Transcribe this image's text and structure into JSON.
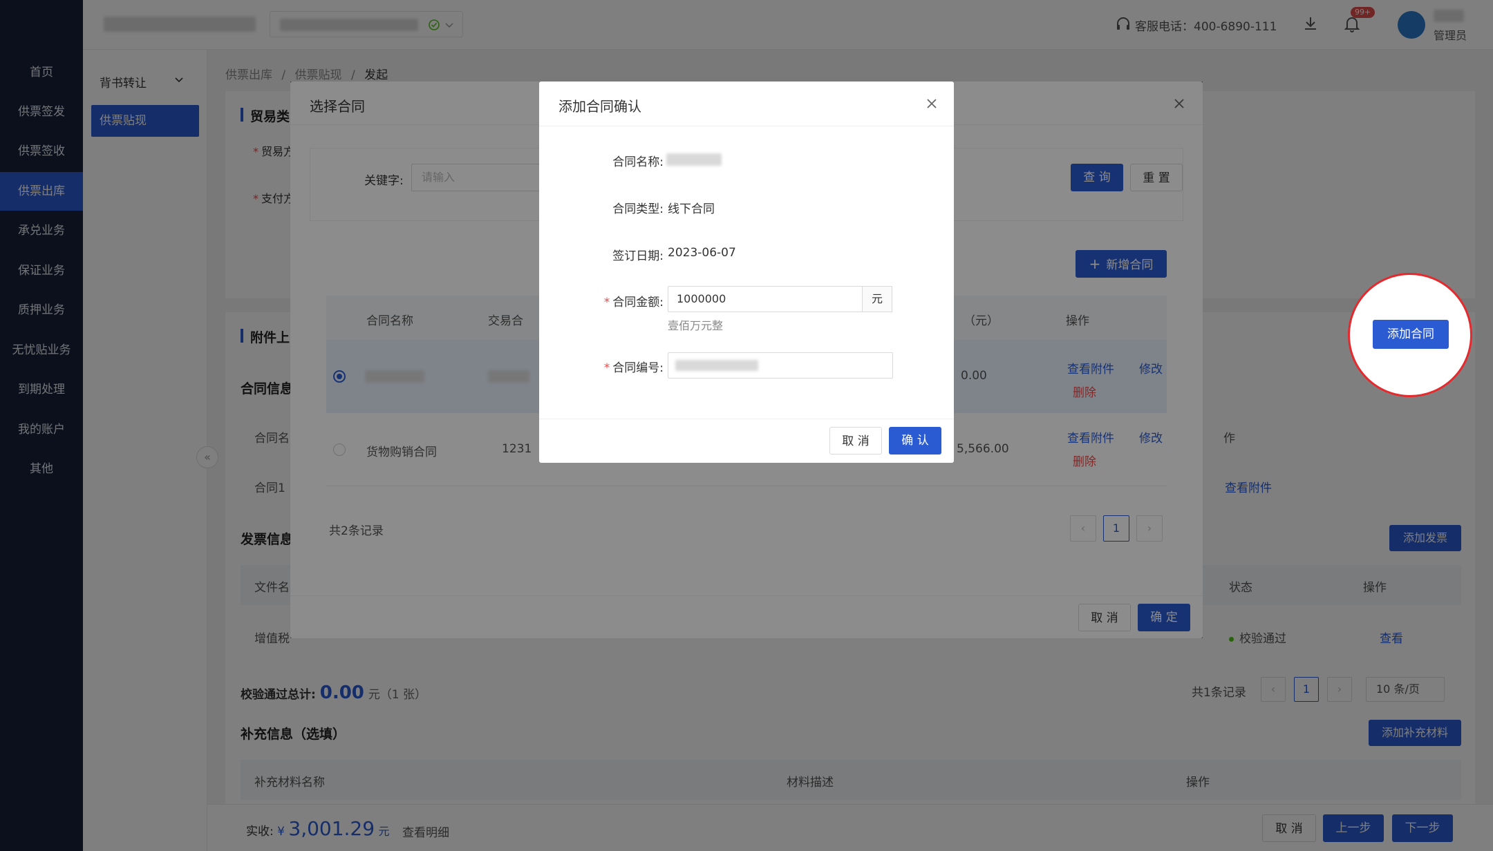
{
  "sidebar": {
    "items": [
      {
        "label": "首页"
      },
      {
        "label": "供票签发"
      },
      {
        "label": "供票签收"
      },
      {
        "label": "供票出库"
      },
      {
        "label": "承兑业务"
      },
      {
        "label": "保证业务"
      },
      {
        "label": "质押业务"
      },
      {
        "label": "无忧贴业务"
      },
      {
        "label": "到期处理"
      },
      {
        "label": "我的账户"
      },
      {
        "label": "其他"
      }
    ]
  },
  "topbar": {
    "hotline": "客服电话：400-6890-111",
    "badge": "99+",
    "role": "管理员"
  },
  "subnav": {
    "group": "背书转让",
    "active": "供票贴现"
  },
  "breadcrumb": {
    "items": [
      "供票出库",
      "供票贴现",
      "发起"
    ]
  },
  "page": {
    "trade_section": "贸易类",
    "trade_field1": "贸易方",
    "trade_field2": "支付方",
    "attach_section": "附件上",
    "contract_info": "合同信息",
    "contract_rows": [
      {
        "name": "合同名"
      },
      {
        "name": "合同1",
        "action": "查看附件"
      }
    ],
    "status_col": "作",
    "invoice_info": "发票信息",
    "add_invoice": "添加发票",
    "invoice_head": {
      "file": "文件名",
      "status": "状态",
      "op": "操作"
    },
    "invoice_row": {
      "file": "增值税",
      "status": "校验通过",
      "op": "查看"
    },
    "verify_total_label": "校验通过总计:",
    "verify_total_value": "0.00",
    "verify_total_unit": "元（1 张）",
    "records": "共1条记录",
    "page_no": "1",
    "page_size": "10 条/页",
    "supplement_title": "补充信息（选填）",
    "add_supplement": "添加补充材料",
    "supplement_head": {
      "name": "补充材料名称",
      "desc": "材料描述",
      "op": "操作"
    },
    "received_label": "实收:",
    "received_currency": "¥",
    "received_value": "3,001.29",
    "received_unit": "元",
    "view_detail": "查看明细",
    "footer_cancel": "取 消",
    "footer_prev": "上一步",
    "footer_next": "下一步"
  },
  "highlight": {
    "label": "添加合同"
  },
  "select_modal": {
    "title": "选择合同",
    "keyword_label": "关键字:",
    "keyword_placeholder": "请输入",
    "query": "查 询",
    "reset": "重 置",
    "new_contract": "新增合同",
    "columns": {
      "name": "合同名称",
      "trade": "交易合",
      "amount": "（元）",
      "op": "操作"
    },
    "rows": [
      {
        "number": "",
        "amount": "0.00",
        "view": "查看附件",
        "edit": "修改",
        "del": "删除"
      },
      {
        "name": "货物购销合同",
        "number": "1231",
        "amount": "5,566.00",
        "view": "查看附件",
        "edit": "修改",
        "del": "删除"
      }
    ],
    "total": "共2条记录",
    "page_no": "1",
    "cancel": "取 消",
    "ok": "确 定"
  },
  "confirm_modal": {
    "title": "添加合同确认",
    "name_label": "合同名称:",
    "type_label": "合同类型:",
    "type_value": "线下合同",
    "date_label": "签订日期:",
    "date_value": "2023-06-07",
    "amount_label": "合同金额:",
    "amount_value": "1000000",
    "amount_unit": "元",
    "amount_words": "壹佰万元整",
    "number_label": "合同编号:",
    "cancel": "取 消",
    "ok": "确 认"
  },
  "colors": {
    "primary": "#2b5bd2",
    "sidebar": "#172138",
    "danger": "#e34d4d",
    "success": "#52c41a"
  }
}
